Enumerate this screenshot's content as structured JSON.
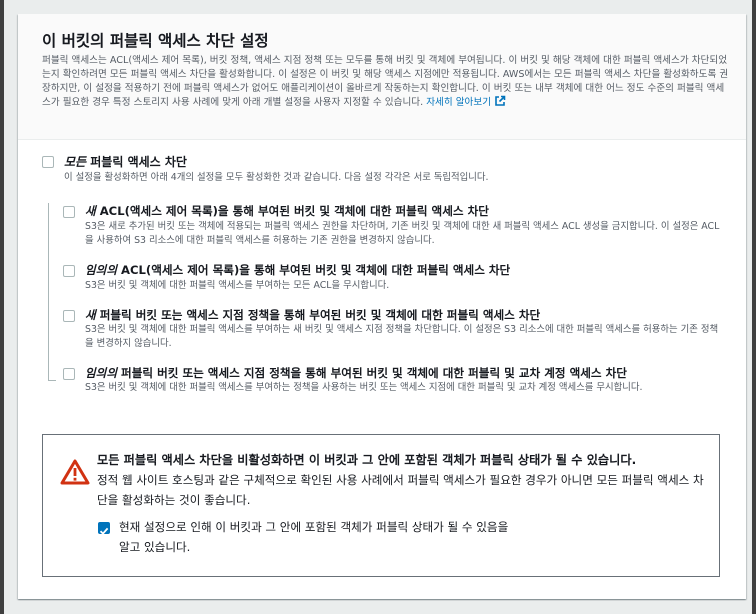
{
  "section": {
    "title": "이 버킷의 퍼블릭 액세스 차단 설정",
    "description": "퍼블릭 액세스는 ACL(액세스 제어 목록), 버킷 정책, 액세스 지점 정책 또는 모두를 통해 버킷 및 객체에 부여됩니다. 이 버킷 및 해당 객체에 대한 퍼블릭 액세스가 차단되었는지 확인하려면 모든 퍼블릭 액세스 차단을 활성화합니다. 이 설정은 이 버킷 및 해당 액세스 지점에만 적용됩니다. AWS에서는 모든 퍼블릭 액세스 차단을 활성화하도록 권장하지만, 이 설정을 적용하기 전에 퍼블릭 액세스가 없어도 애플리케이션이 올바르게 작동하는지 확인합니다. 이 버킷 또는 내부 객체에 대한 어느 정도 수준의 퍼블릭 액세스가 필요한 경우 특정 스토리지 사용 사례에 맞게 아래 개별 설정을 사용자 지정할 수 있습니다.",
    "learn_more": "자세히 알아보기",
    "learn_more_icon": "external-link-icon"
  },
  "block_all": {
    "title_emphasis": "모든",
    "title_rest": " 퍼블릭 액세스 차단",
    "description": "이 설정을 활성화하면 아래 4개의 설정을 모두 활성화한 것과 같습니다. 다음 설정 각각은 서로 독립적입니다.",
    "checked": false
  },
  "options": [
    {
      "title_emphasis": "새",
      "title_rest": " ACL(액세스 제어 목록)을 통해 부여된 버킷 및 객체에 대한 퍼블릭 액세스 차단",
      "description": "S3은 새로 추가된 버킷 또는 객체에 적용되는 퍼블릭 액세스 권한을 차단하며, 기존 버킷 및 객체에 대한 새 퍼블릭 액세스 ACL 생성을 금지합니다. 이 설정은 ACL을 사용하여 S3 리소스에 대한 퍼블릭 액세스를 허용하는 기존 권한을 변경하지 않습니다.",
      "checked": false
    },
    {
      "title_emphasis": "임의의",
      "title_rest": " ACL(액세스 제어 목록)을 통해 부여된 버킷 및 객체에 대한 퍼블릭 액세스 차단",
      "description": "S3은 버킷 및 객체에 대한 퍼블릭 액세스를 부여하는 모든 ACL을 무시합니다.",
      "checked": false
    },
    {
      "title_emphasis": "새",
      "title_rest": " 퍼블릭 버킷 또는 액세스 지점 정책을 통해 부여된 버킷 및 객체에 대한 퍼블릭 액세스 차단",
      "description": "S3은 버킷 및 객체에 대한 퍼블릭 액세스를 부여하는 새 버킷 및 액세스 지점 정책을 차단합니다. 이 설정은 S3 리소스에 대한 퍼블릭 액세스를 허용하는 기존 정책을 변경하지 않습니다.",
      "checked": false
    },
    {
      "title_emphasis": "임의의",
      "title_rest": " 퍼블릭 버킷 또는 액세스 지점 정책을 통해 부여된 버킷 및 객체에 대한 퍼블릭 및 교차 계정 액세스 차단",
      "description": "S3은 버킷 및 객체에 대한 퍼블릭 액세스를 부여하는 정책을 사용하는 버킷 또는 액세스 지점에 대한 퍼블릭 및 교차 계정 액세스를 무시합니다.",
      "checked": false
    }
  ],
  "warning": {
    "icon": "warning-triangle-icon",
    "title": "모든 퍼블릭 액세스 차단을 비활성화하면 이 버킷과 그 안에 포함된 객체가 퍼블릭 상태가 될 수 있습니다.",
    "description": "정적 웹 사이트 호스팅과 같은 구체적으로 확인된 사용 사례에서 퍼블릭 액세스가 필요한 경우가 아니면 모든 퍼블릭 액세스 차단을 활성화하는 것이 좋습니다.",
    "acknowledge_label": "현재 설정으로 인해 이 버킷과 그 안에 포함된 객체가 퍼블릭 상태가 될 수 있음을 알고 있습니다.",
    "acknowledge_checked": true
  },
  "colors": {
    "link": "#0073bb",
    "warning": "#d13212",
    "checkbox_checked": "#0073bb",
    "checkbox_border": "#aab7b8"
  }
}
